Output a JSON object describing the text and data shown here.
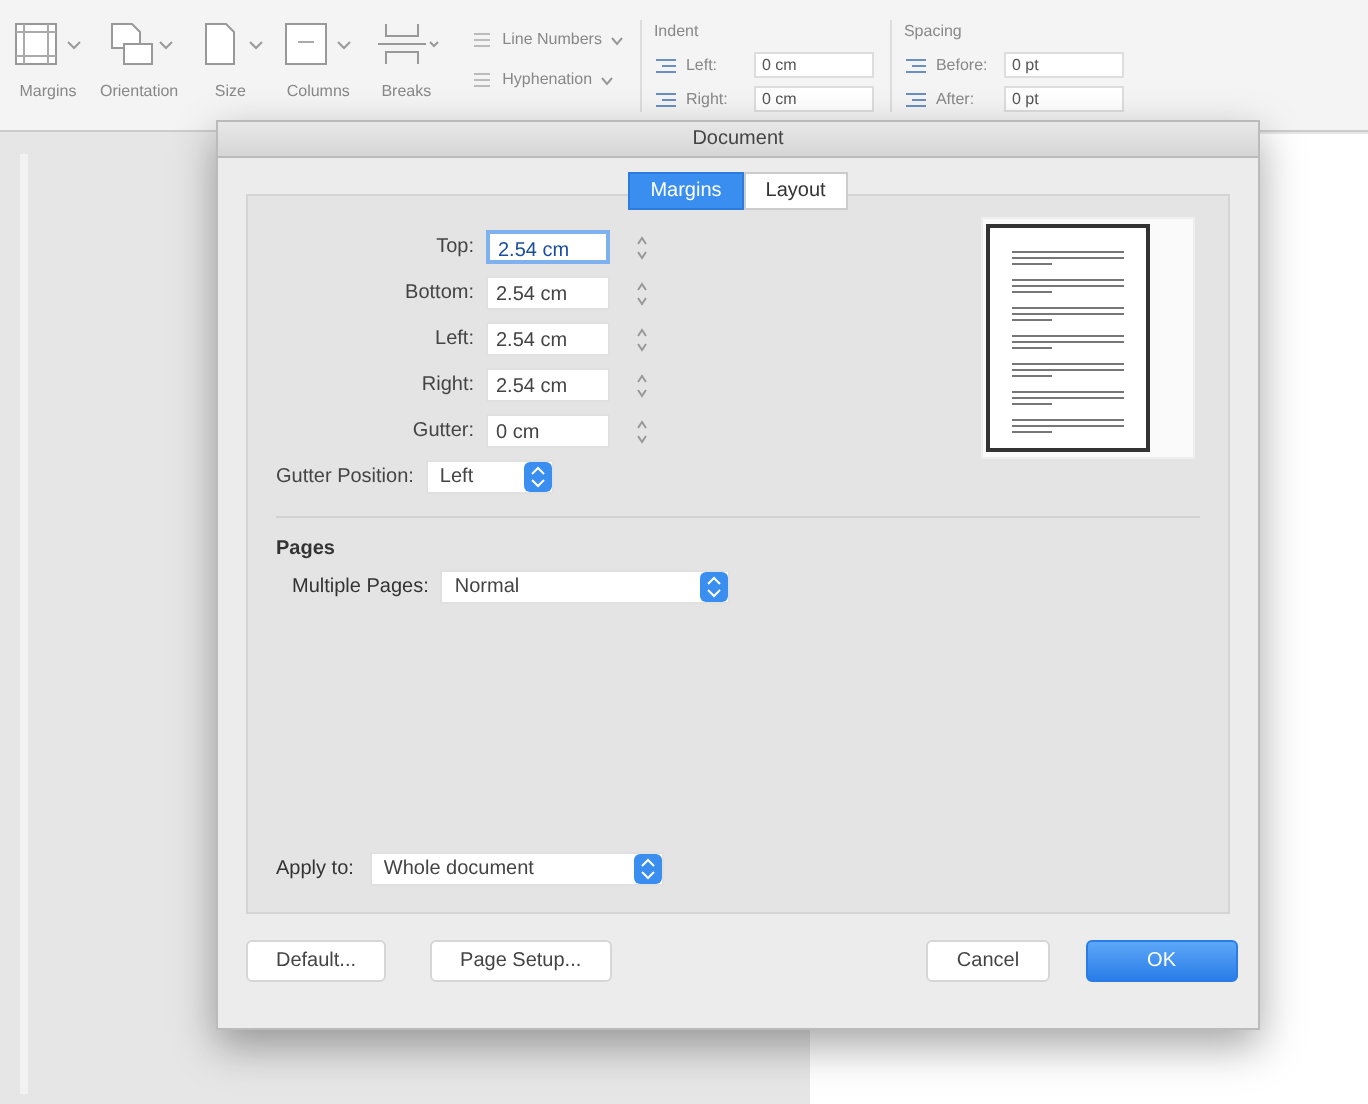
{
  "ribbon": {
    "tools": [
      {
        "label": "Margins"
      },
      {
        "label": "Orientation"
      },
      {
        "label": "Size"
      },
      {
        "label": "Columns"
      },
      {
        "label": "Breaks"
      }
    ],
    "line_numbers": "Line Numbers",
    "hyphenation": "Hyphenation",
    "indent": {
      "title": "Indent",
      "fields": [
        {
          "label": "Left:",
          "value": "0 cm"
        },
        {
          "label": "Right:",
          "value": "0 cm"
        }
      ]
    },
    "spacing": {
      "title": "Spacing",
      "fields": [
        {
          "label": "Before:",
          "value": "0 pt"
        },
        {
          "label": "After:",
          "value": "0 pt"
        }
      ]
    }
  },
  "dialog": {
    "title": "Document",
    "tabs": [
      {
        "label": "Margins",
        "selected": true
      },
      {
        "label": "Layout",
        "selected": false
      }
    ],
    "margins": [
      {
        "label": "Top:",
        "value": "2.54 cm",
        "selected": true
      },
      {
        "label": "Bottom:",
        "value": "2.54 cm",
        "selected": false
      },
      {
        "label": "Left:",
        "value": "2.54 cm",
        "selected": false
      },
      {
        "label": "Right:",
        "value": "2.54 cm",
        "selected": false
      },
      {
        "label": "Gutter:",
        "value": "0 cm",
        "selected": false
      }
    ],
    "gutter_position": {
      "label": "Gutter Position:",
      "value": "Left"
    },
    "pages": {
      "heading": "Pages",
      "label": "Multiple Pages:",
      "value": "Normal"
    },
    "apply_to": {
      "label": "Apply to:",
      "value": "Whole document"
    },
    "buttons": [
      {
        "label": "Default...",
        "kind": "default"
      },
      {
        "label": "Page Setup...",
        "kind": "default"
      },
      {
        "label": "Cancel",
        "kind": "default"
      },
      {
        "label": "OK",
        "kind": "primary"
      }
    ]
  }
}
